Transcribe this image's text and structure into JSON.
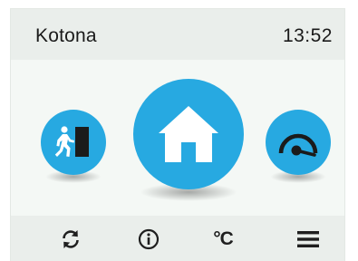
{
  "header": {
    "location": "Kotona",
    "time": "13:52"
  },
  "modes": [
    {
      "id": "away",
      "icon": "away-exit-icon"
    },
    {
      "id": "home",
      "icon": "house-icon",
      "selected": true
    },
    {
      "id": "boost",
      "icon": "speed-gauge-icon"
    }
  ],
  "footer": {
    "sync_icon": "refresh-icon",
    "info_icon": "info-icon",
    "temperature_label": "°C",
    "menu_icon": "hamburger-menu-icon"
  },
  "colors": {
    "accent": "#27a9e1",
    "header_bg": "#eaeeeb",
    "main_bg": "#f4f8f5",
    "text": "#1a1a1a"
  }
}
